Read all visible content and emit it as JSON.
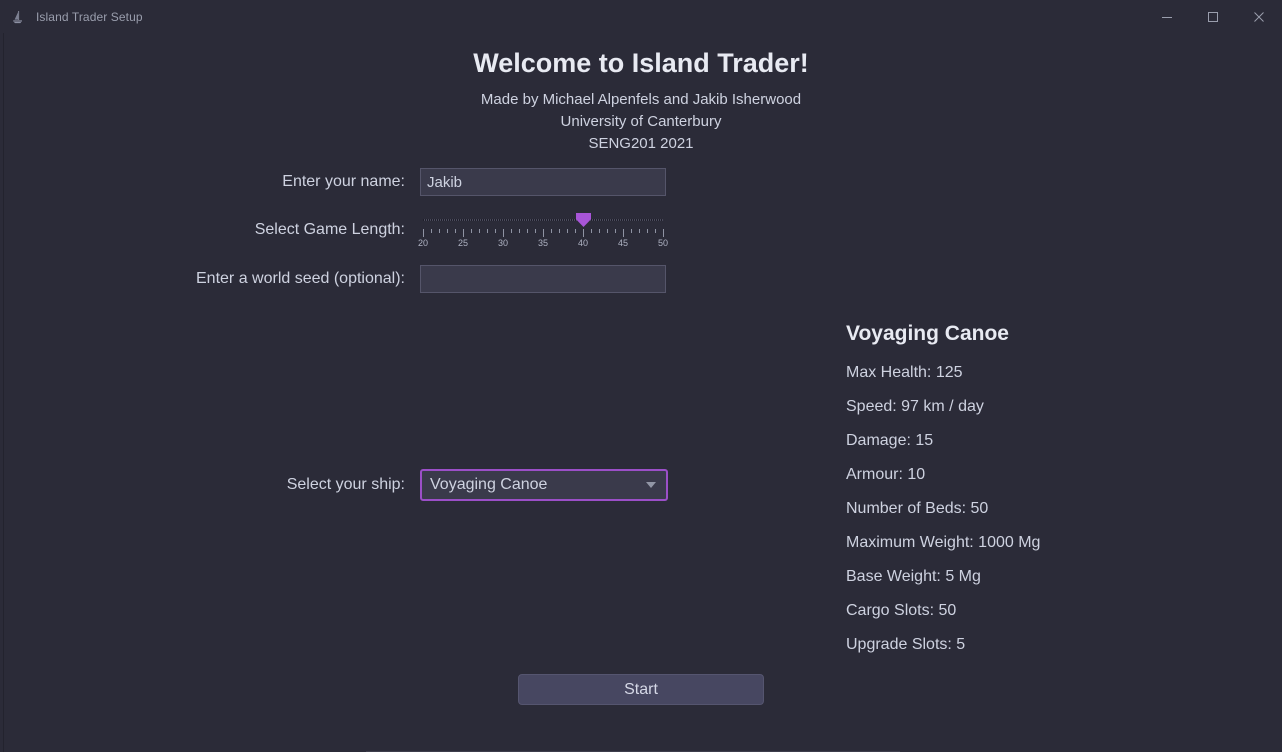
{
  "window": {
    "title": "Island Trader Setup",
    "icon": "sailboat-icon",
    "controls": {
      "minimize": "minimize-icon",
      "maximize": "maximize-icon",
      "close": "close-icon"
    }
  },
  "header": {
    "title": "Welcome to Island Trader!",
    "subtitle_lines": [
      "Made by Michael Alpenfels and Jakib Isherwood",
      "University of Canterbury",
      "SENG201 2021"
    ]
  },
  "form": {
    "name": {
      "label": "Enter your name:",
      "value": "Jakib",
      "placeholder": ""
    },
    "game_length": {
      "label": "Select Game Length:",
      "value": 40,
      "min": 20,
      "max": 50,
      "major_step": 5,
      "minor_step": 1,
      "tick_labels": [
        "20",
        "25",
        "30",
        "35",
        "40",
        "45",
        "50"
      ]
    },
    "world_seed": {
      "label": "Enter a world seed (optional):",
      "value": "",
      "placeholder": ""
    },
    "ship": {
      "label": "Select your ship:",
      "selected": "Voyaging Canoe",
      "options": [
        "Voyaging Canoe"
      ],
      "arrow_icon": "chevron-down-icon"
    }
  },
  "start_button": {
    "label": "Start"
  },
  "ship_stats": {
    "title": "Voyaging Canoe",
    "lines": [
      "Max Health: 125",
      "Speed: 97 km / day",
      "Damage: 15",
      "Armour: 10",
      "Number of Beds: 50",
      "Maximum Weight: 1000 Mg",
      "Base Weight: 5 Mg",
      "Cargo Slots: 50",
      "Upgrade Slots: 5"
    ]
  },
  "colors": {
    "background": "#2b2b38",
    "accent": "#a855d8",
    "field_background": "#3a3a4b",
    "button_background": "#474761",
    "text": "#ced2e0"
  }
}
